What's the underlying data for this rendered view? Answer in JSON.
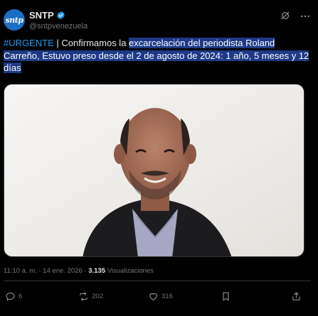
{
  "account": {
    "name": "SNTP",
    "handle": "@sntpvenezuela",
    "avatar_text": "sntp",
    "verified": true
  },
  "tweet": {
    "hashtag": "#URGENTE",
    "text_plain": " | Confirmamos la ",
    "text_highlighted": "excarcelación del periodista Roland Carreño, Estuvo preso desde el 2 de agosto de 2024: 1 año, 5 meses y 12 días"
  },
  "media": {
    "subject": "photo of a smiling man in a dark jacket and plaid shirt"
  },
  "meta": {
    "time": "11:10 a. m.",
    "separator1": " · ",
    "date": "14 ene. 2026",
    "separator2": " · ",
    "views": "3.135",
    "views_label": " Visualizaciones"
  },
  "actions": {
    "replies": "6",
    "retweets": "202",
    "likes": "316"
  },
  "colors": {
    "background": "#000000",
    "accent": "#1d9bf0",
    "highlight": "#1c3a86",
    "muted": "#71767b"
  }
}
